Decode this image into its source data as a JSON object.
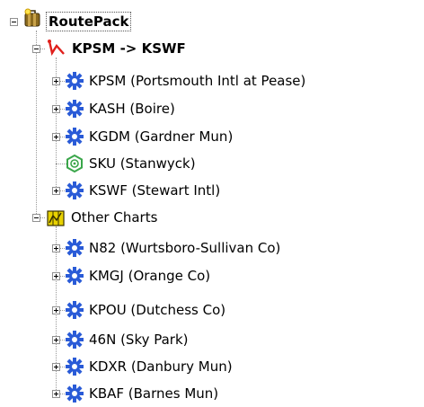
{
  "tree": {
    "root": {
      "label": "RoutePack",
      "icon": "routepack-icon",
      "expanded": true
    },
    "route": {
      "label": "KPSM -> KSWF",
      "icon": "route-icon",
      "color": "#e0201c",
      "expanded": true,
      "items": [
        {
          "label": "KPSM (Portsmouth Intl at Pease)",
          "icon": "airport-icon",
          "expandable": true
        },
        {
          "label": "KASH (Boire)",
          "icon": "airport-icon",
          "expandable": true
        },
        {
          "label": "KGDM (Gardner Mun)",
          "icon": "airport-icon",
          "expandable": true
        },
        {
          "label": "SKU (Stanwyck)",
          "icon": "vor-icon",
          "expandable": false
        },
        {
          "label": "KSWF (Stewart Intl)",
          "icon": "airport-icon",
          "expandable": true
        }
      ]
    },
    "charts": {
      "label": "Other Charts",
      "icon": "charts-folder-icon",
      "expanded": true,
      "items": [
        {
          "label": "N82 (Wurtsboro-Sullivan Co)",
          "icon": "airport-icon"
        },
        {
          "label": "KMGJ (Orange Co)",
          "icon": "airport-icon"
        },
        {
          "label": "KPOU (Dutchess Co)",
          "icon": "airport-icon"
        },
        {
          "label": "46N (Sky Park)",
          "icon": "airport-icon"
        },
        {
          "label": "KDXR (Danbury Mun)",
          "icon": "airport-icon"
        },
        {
          "label": "KBAF (Barnes Mun)",
          "icon": "airport-icon"
        }
      ]
    }
  },
  "colors": {
    "airport": "#2a5bd7",
    "vor": "#3aa64a",
    "folder": "#e8d200",
    "route": "#e0201c"
  }
}
